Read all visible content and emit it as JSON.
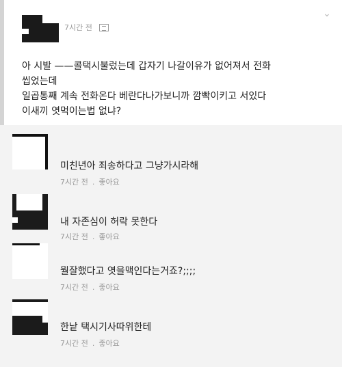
{
  "post": {
    "time": "7시간 전",
    "audience_icon": "friends-icon",
    "menu_icon": "chevron-down-icon",
    "lines": [
      "아 시발 ——콜택시불렀는데 갑자기 나갈이유가 없어져서 전화",
      "씹었는데",
      "일곱통째 계속 전화온다 베란다나가보니까 깜빡이키고 서있다",
      "이새끼 엿먹이는법 없냐?"
    ]
  },
  "comments": [
    {
      "text": "미친년아 죄송하다고 그냥가시라해",
      "time": "7시간 전",
      "like": "좋아요"
    },
    {
      "text": "내 자존심이 허락 못한다",
      "time": "7시간 전",
      "like": "좋아요"
    },
    {
      "text": "뭘잘했다고 엿을맥인다는거죠?;;;;",
      "time": "7시간 전",
      "like": "좋아요"
    },
    {
      "text": "한낱 택시기사따위한테",
      "time": "7시간 전",
      "like": "좋아요"
    }
  ],
  "colors": {
    "background": "#f3f3f3",
    "card": "#ffffff",
    "meta": "#9a9a9a",
    "text": "#222222"
  }
}
